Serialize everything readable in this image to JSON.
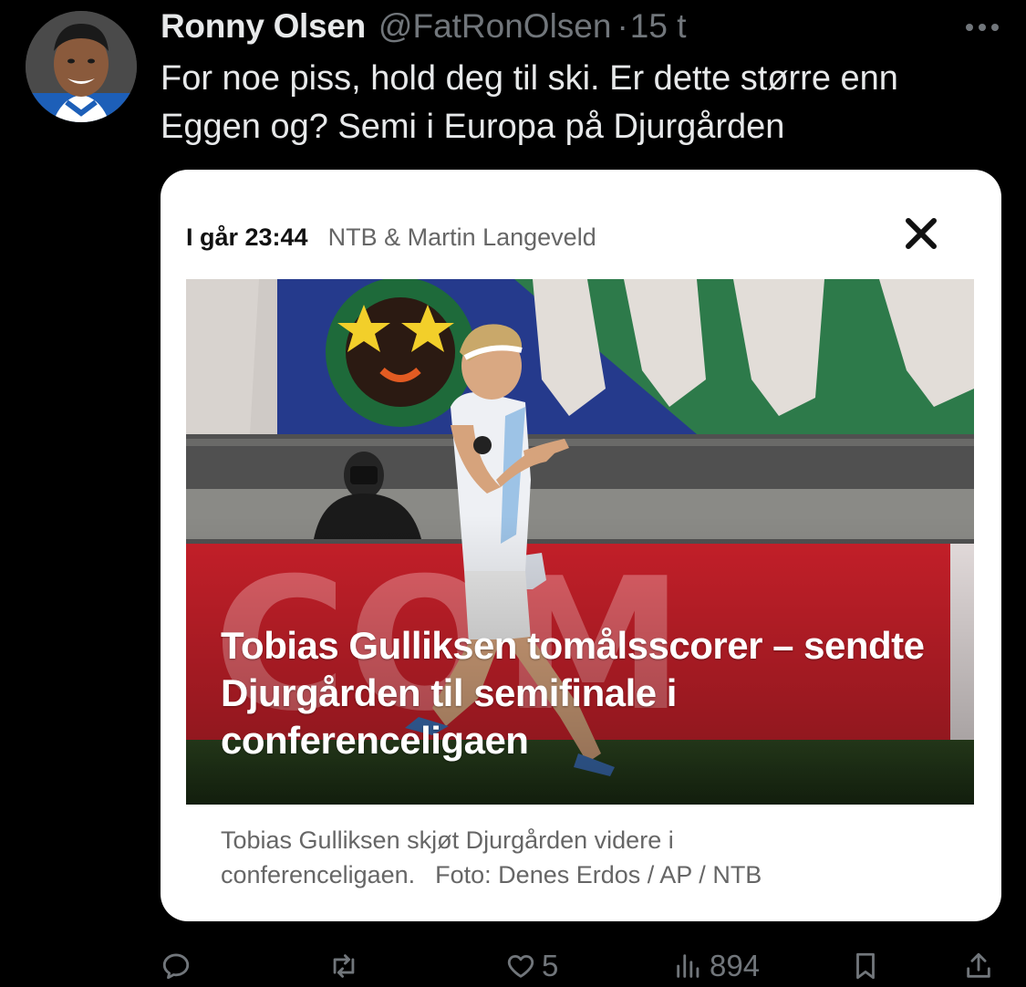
{
  "tweet": {
    "author_name": "Ronny Olsen",
    "handle": "@FatRonOlsen",
    "separator": "·",
    "time": "15 t",
    "text": "For noe piss, hold deg til ski. Er dette større enn Eggen og? Semi i Europa på Djurgården"
  },
  "card": {
    "time": "I går 23:44",
    "author": "NTB & Martin Langeveld",
    "headline": "Tobias Gulliksen tomålsscorer – sendte Djurgården til semifinale i conferenceligaen",
    "caption_text": "Tobias Gulliksen skjøt Djurgården videre i conferenceligaen.",
    "caption_credit": "Foto: Denes Erdos / AP / NTB"
  },
  "actions": {
    "reply": {
      "icon": "reply-icon",
      "count": ""
    },
    "retweet": {
      "icon": "retweet-icon",
      "count": ""
    },
    "like": {
      "icon": "heart-icon",
      "count": "5"
    },
    "views": {
      "icon": "views-icon",
      "count": "894"
    },
    "bookmark": {
      "icon": "bookmark-icon"
    },
    "share": {
      "icon": "share-icon"
    }
  },
  "colors": {
    "background": "#000000",
    "text_primary": "#e7e9ea",
    "text_secondary": "#71767b",
    "card_background": "#ffffff",
    "ad_board_red": "#c8202a"
  }
}
